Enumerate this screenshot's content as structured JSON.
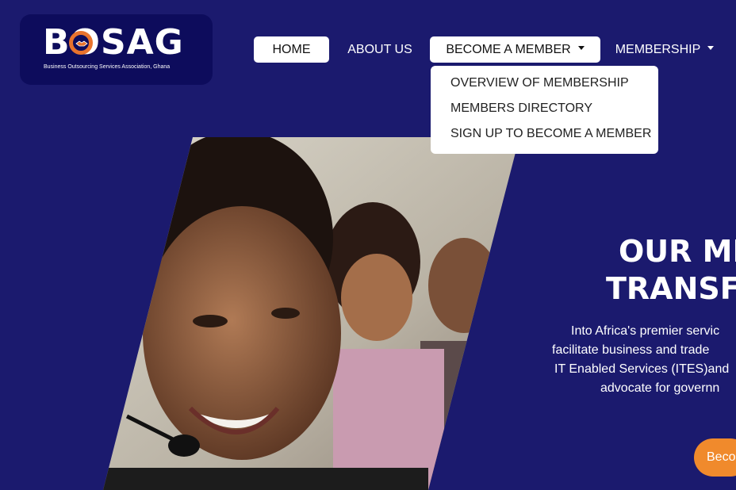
{
  "logo": {
    "wordmark": "BOSAG",
    "tagline": "Business Outsourcing Services Association, Ghana"
  },
  "nav": {
    "home": "HOME",
    "about": "ABOUT US",
    "become_member": "BECOME A MEMBER",
    "membership": "MEMBERSHIP"
  },
  "dropdown": {
    "items": [
      "OVERVIEW OF MEMBERSHIP",
      "MEMBERS DIRECTORY",
      "SIGN UP TO BECOME A MEMBER"
    ]
  },
  "hero": {
    "title_line1": "OUR MIS",
    "title_line2": "TRANSFO",
    "para_lines": [
      "Into Africa's premier servic",
      "facilitate business and trade",
      "IT Enabled Services (ITES)and",
      "advocate for governn"
    ],
    "cta": "Beco"
  },
  "colors": {
    "background": "#1b1a6e",
    "logo_bg": "#0d0c5c",
    "accent": "#e8732d",
    "cta": "#f08a2c"
  }
}
